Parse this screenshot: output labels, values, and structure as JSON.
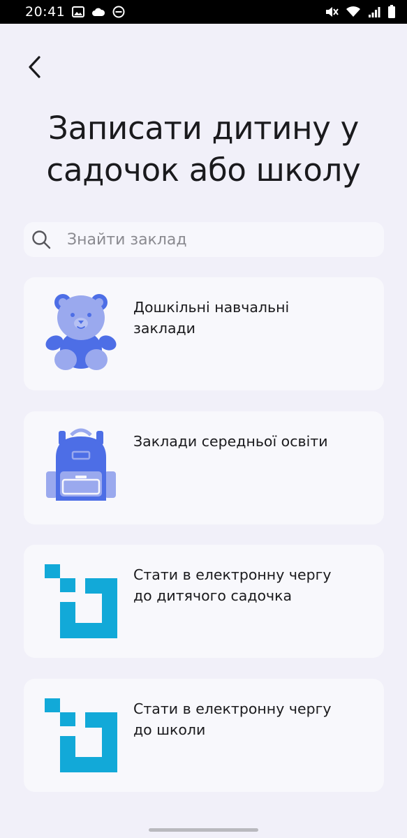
{
  "status_bar": {
    "time": "20:41"
  },
  "header": {
    "title": "Записати дитину у\nсадочок або школу"
  },
  "search": {
    "placeholder": "Знайти заклад",
    "value": ""
  },
  "categories": [
    {
      "label": "Дошкільні навчальні\nзаклади",
      "icon": "teddy-bear-icon"
    },
    {
      "label": "Заклади середньої освіти",
      "icon": "backpack-icon"
    },
    {
      "label": "Стати в електронну чергу\nдо дитячого садочка",
      "icon": "queue-logo-icon"
    },
    {
      "label": "Стати в електронну чергу\nдо школи",
      "icon": "queue-logo-icon"
    }
  ],
  "colors": {
    "background": "#f1f0f9",
    "card": "#f8f8fc",
    "icon_blue_dark": "#4d6ee6",
    "icon_blue_light": "#9aa9ee",
    "queue_cyan": "#12a9d8",
    "text": "#1a1a1d"
  }
}
